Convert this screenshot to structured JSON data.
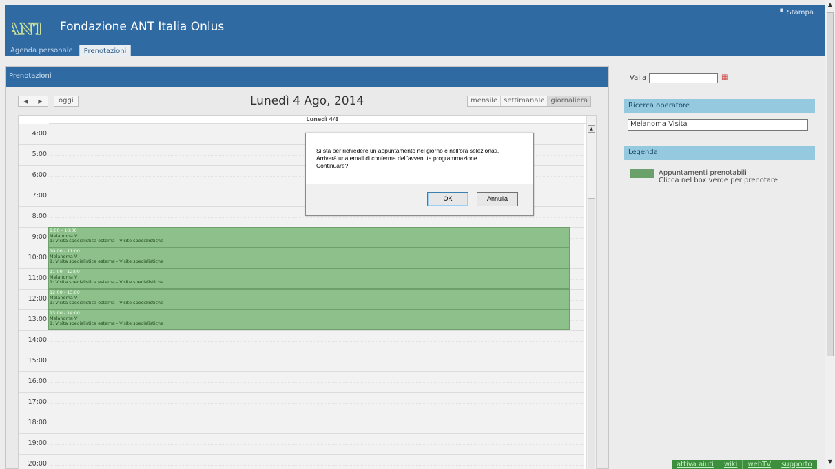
{
  "header": {
    "title": "Fondazione ANT Italia Onlus",
    "logo_text": "ANT",
    "print_label": "Stampa",
    "tabs": [
      {
        "label": "Agenda personale"
      },
      {
        "label": "Prenotazioni"
      }
    ]
  },
  "panel": {
    "tab_label": "Prenotazioni",
    "today_label": "oggi",
    "title": "Lunedì 4 Ago, 2014",
    "views": [
      {
        "label": "mensile"
      },
      {
        "label": "settimanale"
      },
      {
        "label": "giornaliera"
      }
    ],
    "day_header": "Lunedì 4/8",
    "hours": [
      "4:00",
      "5:00",
      "6:00",
      "7:00",
      "8:00",
      "9:00",
      "10:00",
      "11:00",
      "12:00",
      "13:00",
      "14:00",
      "15:00",
      "16:00",
      "17:00",
      "18:00",
      "19:00",
      "20:00"
    ],
    "events": [
      {
        "time": "9:00 - 10:00",
        "name": "Melanoma V",
        "desc": "1: Visita specialistica esterna - Visite specialistiche"
      },
      {
        "time": "10:00 - 11:00",
        "name": "Melanoma V",
        "desc": "1: Visita specialistica esterna - Visite specialistiche"
      },
      {
        "time": "11:00 - 12:00",
        "name": "Melanoma V",
        "desc": "1: Visita specialistica esterna - Visite specialistiche"
      },
      {
        "time": "12:00 - 13:00",
        "name": "Melanoma V",
        "desc": "1: Visita specialistica esterna - Visite specialistiche"
      },
      {
        "time": "13:00 - 14:00",
        "name": "Melanoma V",
        "desc": "1: Visita specialistica esterna - Visite specialistiche"
      }
    ]
  },
  "sidebar": {
    "goto_label": "Vai a",
    "goto_value": "",
    "operator_heading": "Ricerca operatore",
    "operator_value": "Melanoma Visita",
    "legend_heading": "Legenda",
    "legend_line1": "Appuntamenti prenotabili",
    "legend_line2": "Clicca nel box verde per prenotare",
    "legend_color": "#6aa16a"
  },
  "footer": {
    "links": [
      {
        "label": "attiva aiuti"
      },
      {
        "label": "wiki"
      },
      {
        "label": "webTV"
      },
      {
        "label": "supporto"
      }
    ]
  },
  "modal": {
    "message_line1": "Si sta per richiedere un appuntamento nel giorno e nell'ora selezionati.",
    "message_line2": "Arriverà una email di conferma dell'avvenuta programmazione.",
    "message_line3": "Continuare?",
    "ok_label": "OK",
    "cancel_label": "Annulla"
  },
  "colors": {
    "header_blue": "#2f6aa3",
    "event_green": "#8dc08a",
    "side_head": "#94c9e0",
    "footer_green": "#3d8f3d"
  }
}
